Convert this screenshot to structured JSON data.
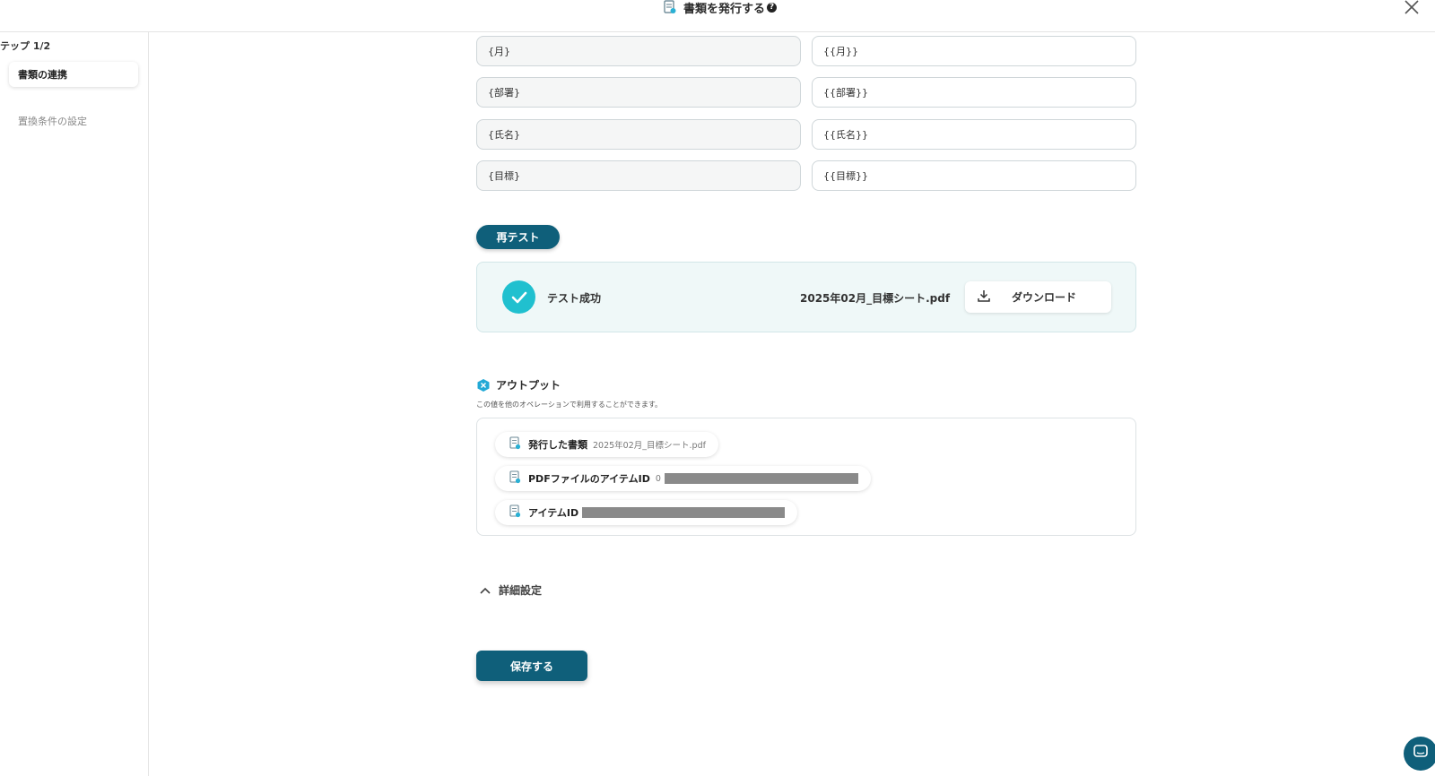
{
  "header": {
    "title": "書類を発行する",
    "help_glyph": "?"
  },
  "sidebar": {
    "step_label": "テップ 1/2",
    "items": [
      {
        "label": "書類の連携"
      },
      {
        "label": "置換条件の設定"
      }
    ]
  },
  "fields": [
    {
      "left": "{月}",
      "right": "{{月}}"
    },
    {
      "left": "{部署}",
      "right": "{{部署}}"
    },
    {
      "left": "{氏名}",
      "right": "{{氏名}}"
    },
    {
      "left": "{目標}",
      "right": "{{目標}}"
    }
  ],
  "retest_label": "再テスト",
  "result": {
    "status": "テスト成功",
    "filename": "2025年02月_目標シート.pdf",
    "download_label": "ダウンロード"
  },
  "output": {
    "title": "アウトプット",
    "description": "この値を他のオペレーションで利用することができます。",
    "chips": [
      {
        "label": "発行した書類",
        "value": "2025年02月_目標シート.pdf"
      },
      {
        "label": "PDFファイルのアイテムID",
        "value": "0"
      },
      {
        "label": "アイテムID",
        "value": ""
      }
    ]
  },
  "advanced_label": "詳細設定",
  "save_label": "保存する",
  "colors": {
    "primary": "#0f5f7a",
    "success": "#20c0cf",
    "result_bg": "#eff8f8"
  }
}
